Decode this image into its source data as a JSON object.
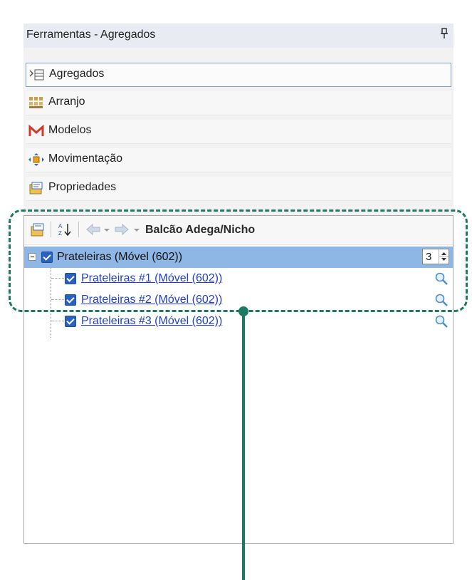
{
  "panel": {
    "title": "Ferramentas - Agregados",
    "pin_glyph": "ᵖ"
  },
  "nav_items": [
    {
      "label": "Agregados",
      "icon": "agregados-icon",
      "selected": true
    },
    {
      "label": "Arranjo",
      "icon": "arranjo-icon",
      "selected": false
    },
    {
      "label": "Modelos",
      "icon": "modelos-icon",
      "selected": false
    },
    {
      "label": "Movimentação",
      "icon": "movimentacao-icon",
      "selected": false
    },
    {
      "label": "Propriedades",
      "icon": "propriedades-icon",
      "selected": false
    }
  ],
  "tree_toolbar": {
    "breadcrumb": "Balcão Adega/Nicho",
    "sort_glyph": "A↓Z"
  },
  "tree": {
    "root": {
      "label": "Prateleiras (Móvel (602))",
      "quantity": "3",
      "checked": true
    },
    "children": [
      {
        "label": "Prateleiras #1 (Móvel (602))",
        "checked": true
      },
      {
        "label": "Prateleiras #2 (Móvel (602))",
        "checked": true
      },
      {
        "label": "Prateleiras #3 (Móvel (602))",
        "checked": true
      }
    ]
  },
  "colors": {
    "annotation": "#1d7a62",
    "selection": "#8fb7e6",
    "link": "#1f3fc9"
  }
}
